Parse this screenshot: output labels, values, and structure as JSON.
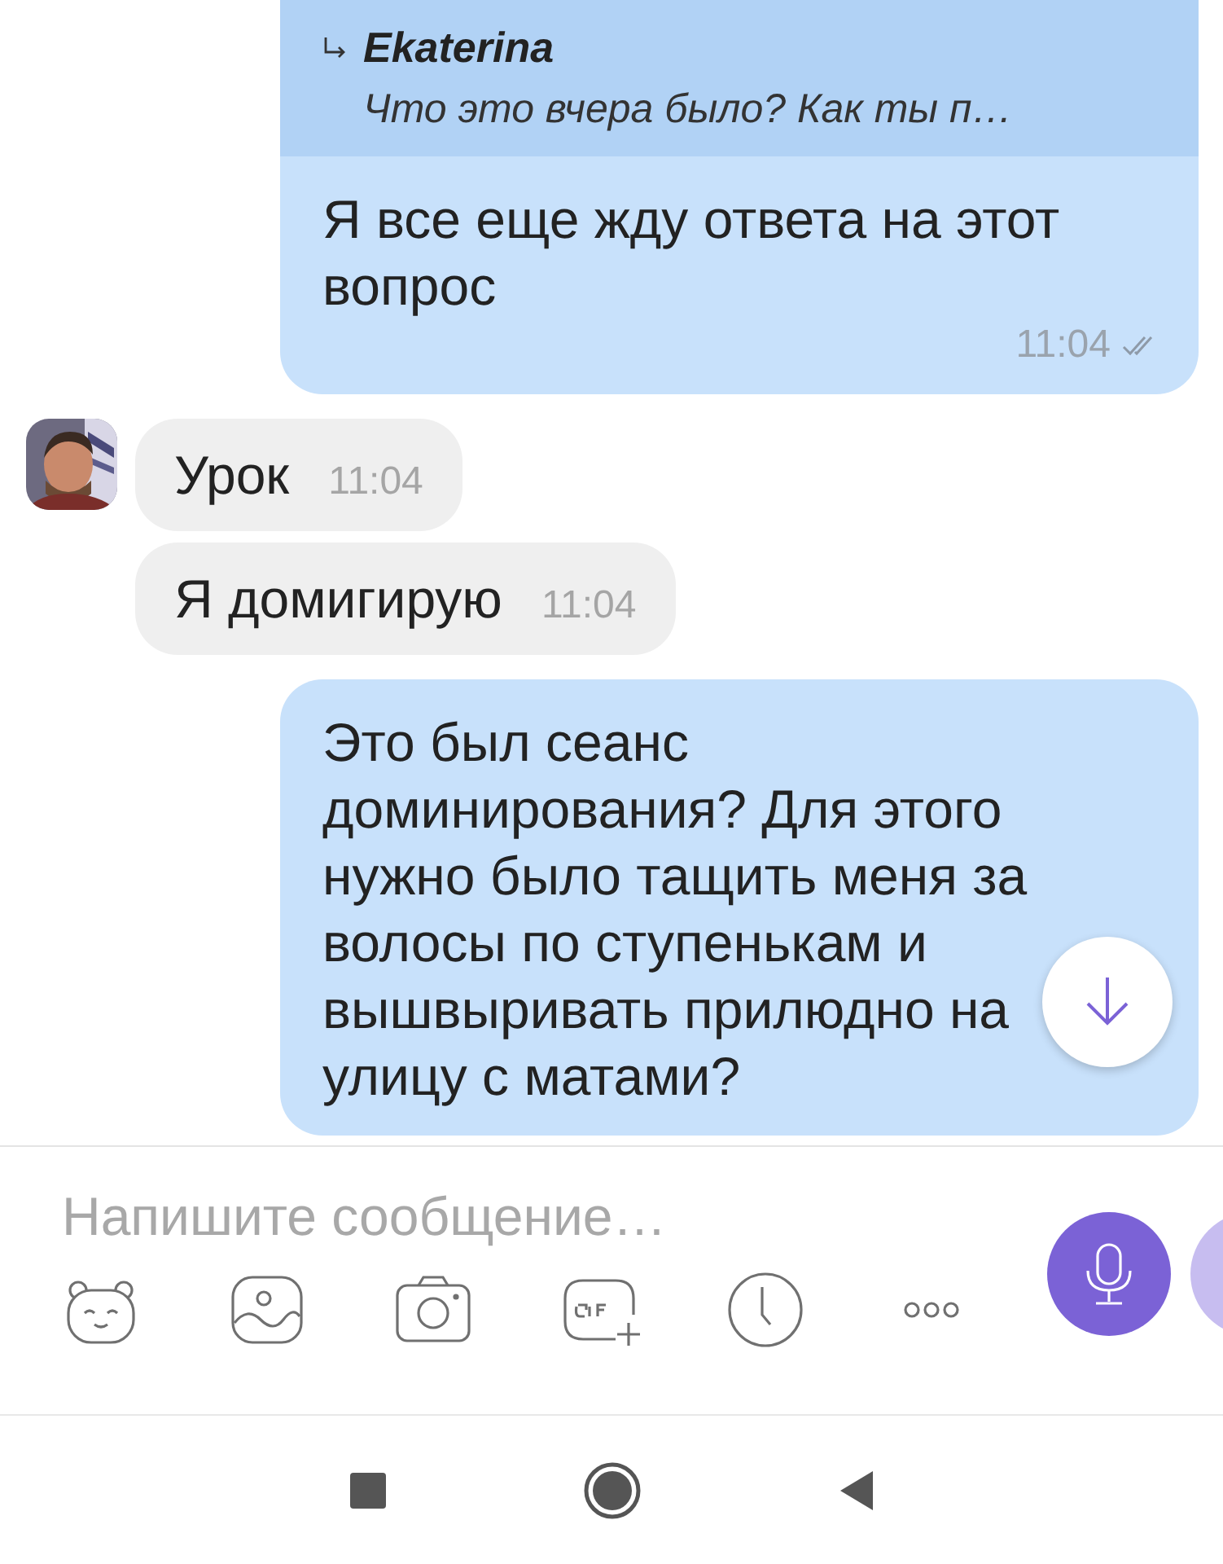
{
  "messages": [
    {
      "kind": "outgoing",
      "reply": {
        "author": "Ekaterina",
        "text": "Что это вчера было? Как ты п…"
      },
      "text": "Я все еще жду ответа на этот\nвопрос",
      "time": "11:04",
      "read": true
    },
    {
      "kind": "incoming",
      "avatar": true,
      "text": "Урок",
      "time": "11:04"
    },
    {
      "kind": "incoming",
      "text": "Я домигирую",
      "time": "11:04"
    },
    {
      "kind": "outgoing",
      "text": "Это был сеанс\nдоминирования? Для этого\nнужно было тащить меня за\nволосы по ступенькам и\nвышвыривать прилюдно на\nулицу с матами?"
    }
  ],
  "composer": {
    "placeholder": "Напишите сообщение…"
  }
}
